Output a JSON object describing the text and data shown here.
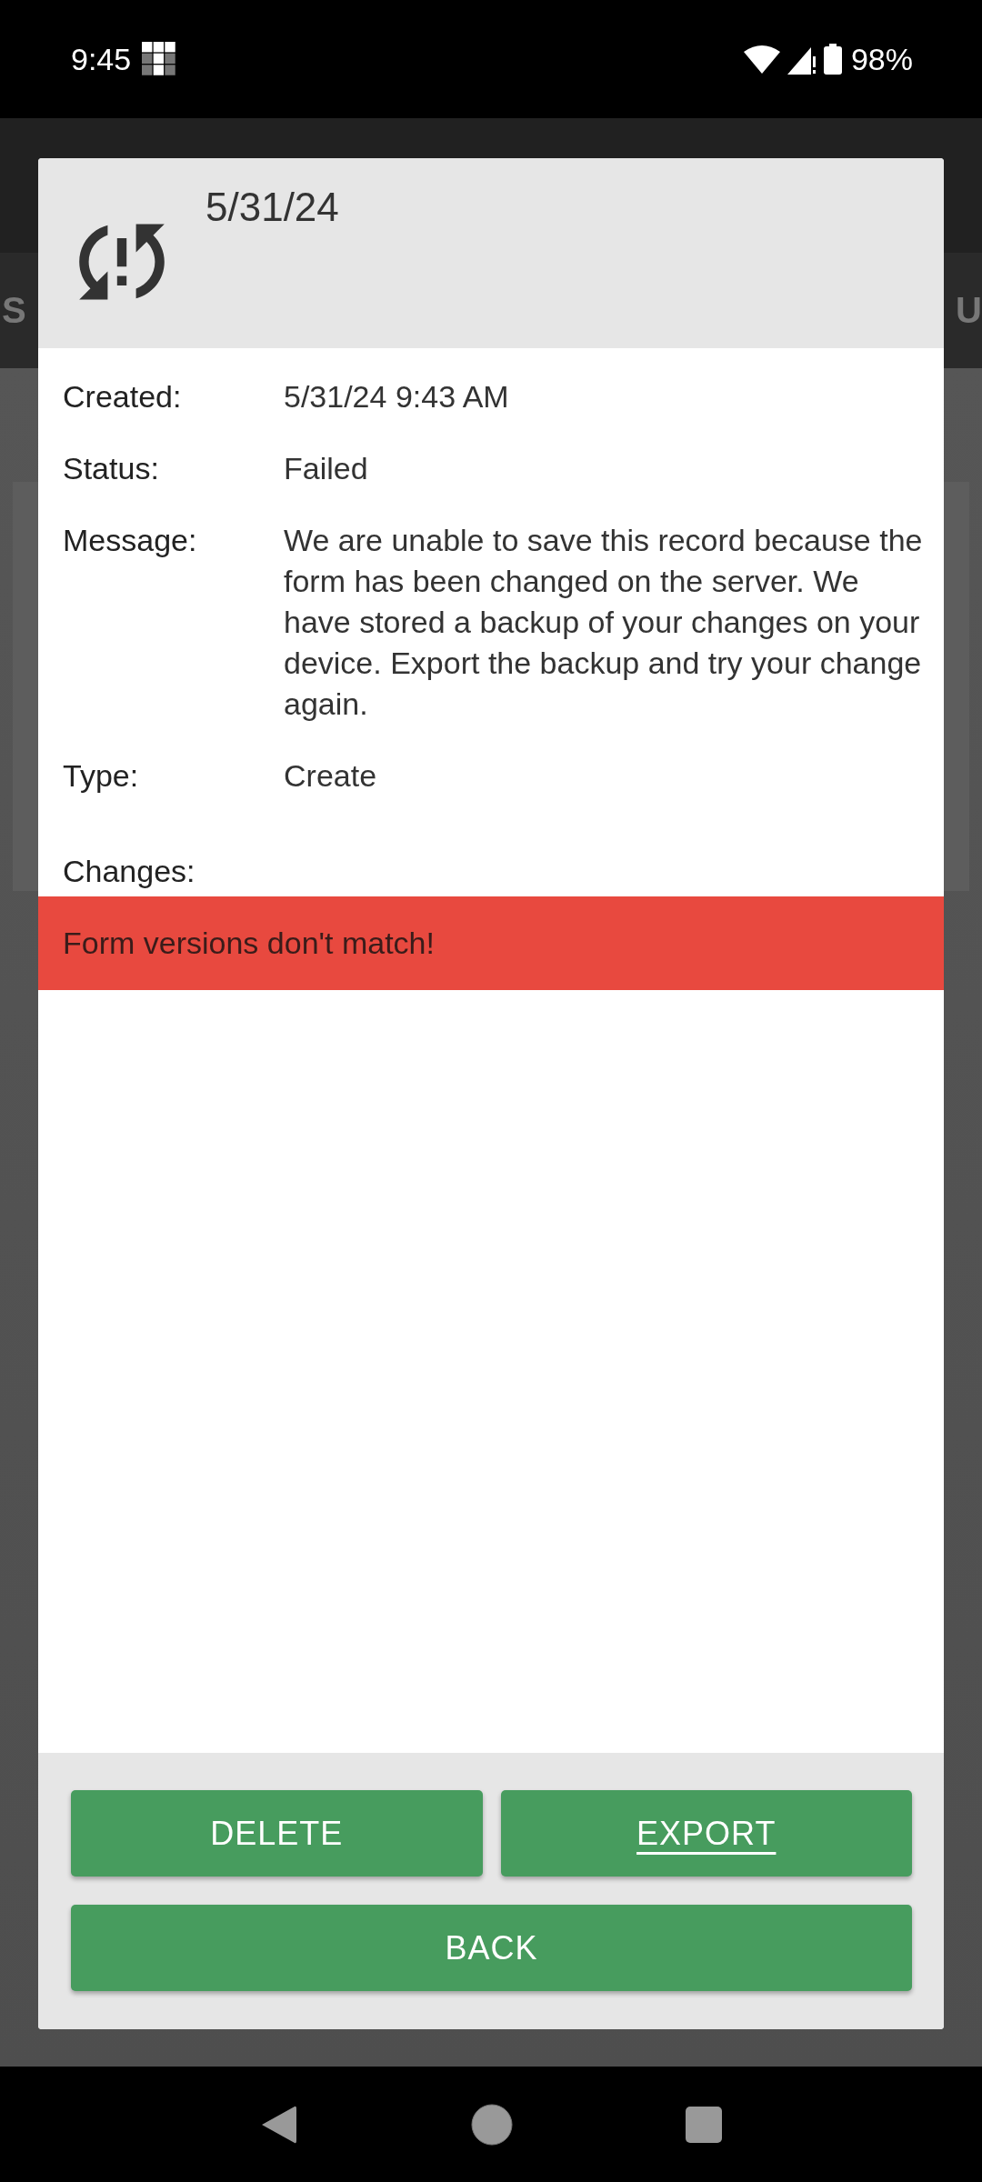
{
  "status_bar": {
    "time": "9:45",
    "battery": "98%"
  },
  "background": {
    "tab_left": "S",
    "tab_right": "U"
  },
  "dialog": {
    "title": "5/31/24",
    "fields": [
      {
        "label": "Created:",
        "value": "5/31/24 9:43 AM"
      },
      {
        "label": "Status:",
        "value": "Failed"
      },
      {
        "label": "Message:",
        "value": "We are unable to save this record because the form has been changed on the server. We have stored a backup of your changes on your device. Export the backup and try your change again."
      },
      {
        "label": "Type:",
        "value": "Create"
      }
    ],
    "changes_label": "Changes:",
    "alert": "Form versions don't match!",
    "buttons": [
      {
        "label": "DELETE",
        "focused": false
      },
      {
        "label": "EXPORT",
        "focused": true
      },
      {
        "label": "BACK",
        "focused": false
      }
    ]
  }
}
